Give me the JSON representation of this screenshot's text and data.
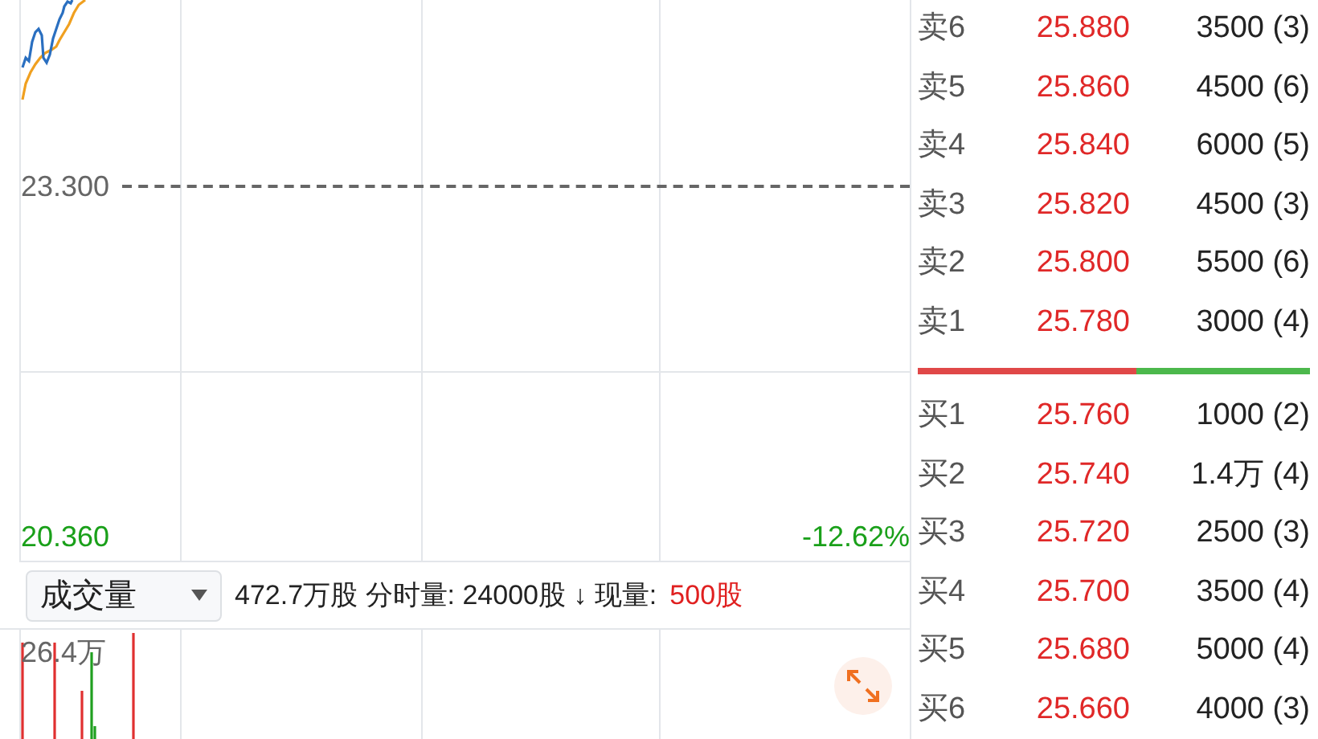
{
  "price_chart": {
    "reference_price": "23.300",
    "low_price": "20.360",
    "low_change": "-12.62%"
  },
  "volume_bar": {
    "selector": "成交量",
    "stats": "472.7万股 分时量: 24000股 ↓ 现量:",
    "current_value": "500股"
  },
  "volume_chart": {
    "max_label": "26.4万"
  },
  "order_book": {
    "asks": [
      {
        "label": "卖6",
        "price": "25.880",
        "volume": "3500 (3)"
      },
      {
        "label": "卖5",
        "price": "25.860",
        "volume": "4500 (6)"
      },
      {
        "label": "卖4",
        "price": "25.840",
        "volume": "6000 (5)"
      },
      {
        "label": "卖3",
        "price": "25.820",
        "volume": "4500 (3)"
      },
      {
        "label": "卖2",
        "price": "25.800",
        "volume": "5500 (6)"
      },
      {
        "label": "卖1",
        "price": "25.780",
        "volume": "3000 (4)"
      }
    ],
    "ratio": {
      "level": 0.557
    },
    "bids": [
      {
        "label": "买1",
        "price": "25.760",
        "volume": "1000 (2)"
      },
      {
        "label": "买2",
        "price": "25.740",
        "volume": "1.4万 (4)"
      },
      {
        "label": "买3",
        "price": "25.720",
        "volume": "2500 (3)"
      },
      {
        "label": "买4",
        "price": "25.700",
        "volume": "3500 (4)"
      },
      {
        "label": "买5",
        "price": "25.680",
        "volume": "5000 (4)"
      },
      {
        "label": "买6",
        "price": "25.660",
        "volume": "4000 (3)"
      }
    ]
  }
}
